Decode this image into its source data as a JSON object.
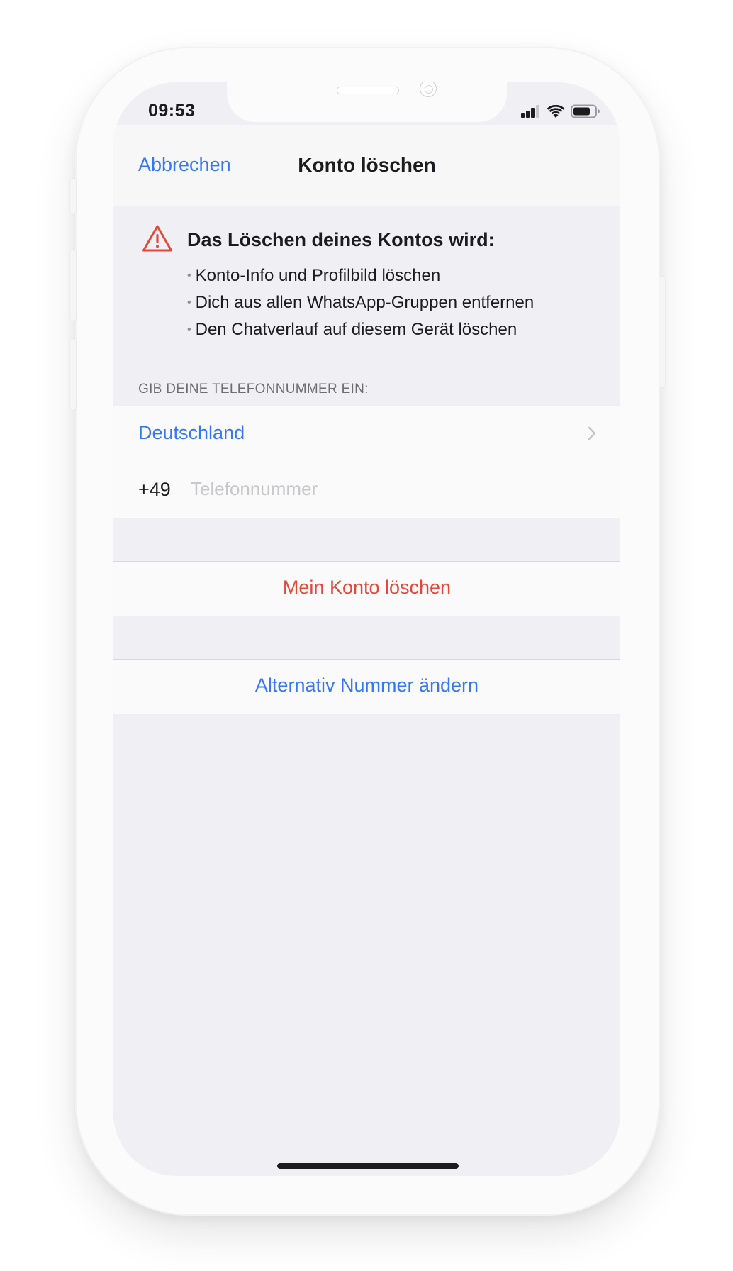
{
  "status_bar": {
    "time": "09:53",
    "signal_icon": "cellular-signal-icon",
    "wifi_icon": "wifi-icon",
    "battery_icon": "battery-icon"
  },
  "navbar": {
    "cancel_label": "Abbrechen",
    "title": "Konto löschen"
  },
  "warning": {
    "icon": "warning-triangle-icon",
    "icon_color": "#e5483b",
    "title": "Das Löschen deines Kontos wird:",
    "items": [
      "Konto-Info und Profilbild löschen",
      "Dich aus allen WhatsApp-Gruppen entfernen",
      "Den Chatverlauf auf diesem Gerät löschen"
    ]
  },
  "phone_section": {
    "header": "GIB DEINE TELEFONNUMMER EIN:",
    "country": "Deutschland",
    "country_chevron_icon": "chevron-right-icon",
    "country_code": "+49",
    "phone_value": "",
    "phone_placeholder": "Telefonnummer"
  },
  "actions": {
    "delete_label": "Mein Konto löschen",
    "change_number_label": "Alternativ Nummer ändern"
  },
  "colors": {
    "accent_blue": "#3478f6",
    "destructive_red": "#e5483b",
    "background": "#efeff4"
  }
}
